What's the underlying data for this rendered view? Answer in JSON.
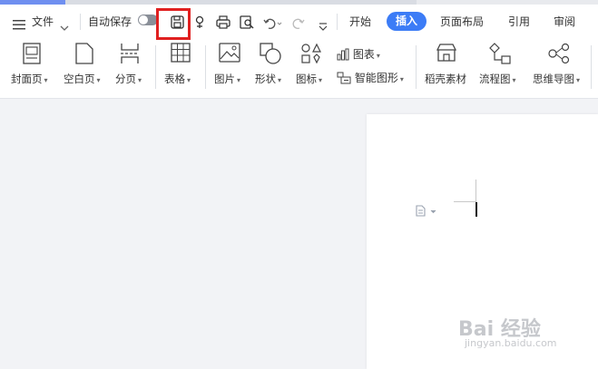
{
  "toolbar": {
    "menu_label": "文件",
    "autosave_label": "自动保存",
    "autosave_state": "off"
  },
  "tabs": [
    "开始",
    "插入",
    "页面布局",
    "引用",
    "审阅"
  ],
  "active_tab": "插入",
  "accent_color": "#3c7cf6",
  "highlight_color": "#e02020",
  "ribbon": {
    "cover_label": "封面页",
    "blank_label": "空白页",
    "break_label": "分页",
    "table_label": "表格",
    "picture_label": "图片",
    "shape_label": "形状",
    "icon_label": "图标",
    "chart_label": "图表",
    "smartart_label": "智能图形",
    "material_label": "稻壳素材",
    "flowchart_label": "流程图",
    "mindmap_label": "思维导图"
  },
  "watermark": {
    "main": "Bai 经验",
    "sub": "jingyan.baidu.com"
  }
}
